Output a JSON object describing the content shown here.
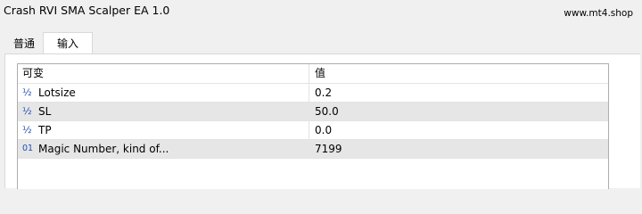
{
  "window": {
    "title": "Crash RVI SMA Scalper EA 1.0",
    "watermark": "www.mt4.shop"
  },
  "tabs": [
    {
      "label": "普通",
      "active": false
    },
    {
      "label": "输入",
      "active": true
    }
  ],
  "grid": {
    "headers": {
      "name": "可变",
      "value": "值"
    },
    "rows": [
      {
        "icon": "double-type-icon",
        "icon_glyph": "½",
        "name": "Lotsize",
        "value": "0.2"
      },
      {
        "icon": "double-type-icon",
        "icon_glyph": "½",
        "name": "SL",
        "value": "50.0"
      },
      {
        "icon": "double-type-icon",
        "icon_glyph": "½",
        "name": "TP",
        "value": "0.0"
      },
      {
        "icon": "integer-type-icon",
        "icon_glyph": "01",
        "name": "Magic Number, kind of...",
        "value": "7199"
      }
    ]
  },
  "colors": {
    "icon_blue": "#1f4fb5",
    "row_shade": "#e6e6e6",
    "background": "#f0f0f0"
  }
}
